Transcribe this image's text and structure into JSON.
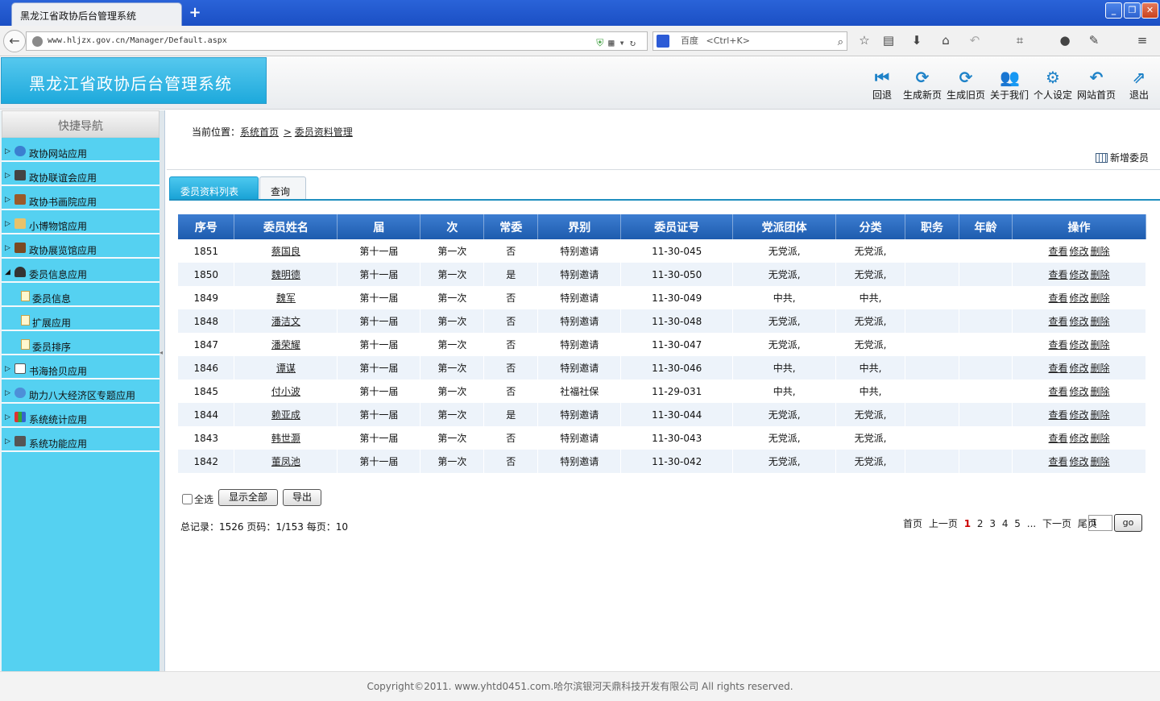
{
  "browser": {
    "tab_title": "黑龙江省政协后台管理系统",
    "new_tab": "+",
    "url": "www.hljzx.gov.cn/Manager/Default.aspx",
    "search_engine": "百度",
    "search_hint": "<Ctrl+K>"
  },
  "header": {
    "app_title": "黑龙江省政协后台管理系统",
    "buttons": [
      {
        "label": "回退",
        "icon": "rewind-icon"
      },
      {
        "label": "生成新页",
        "icon": "refresh-icon"
      },
      {
        "label": "生成旧页",
        "icon": "refresh-icon"
      },
      {
        "label": "关于我们",
        "icon": "users-icon"
      },
      {
        "label": "个人设定",
        "icon": "gear-icon"
      },
      {
        "label": "网站首页",
        "icon": "back-arrow-icon"
      },
      {
        "label": "退出",
        "icon": "exit-icon"
      }
    ]
  },
  "sidebar": {
    "title": "快捷导航",
    "items": [
      {
        "label": "政协网站应用"
      },
      {
        "label": "政协联谊会应用"
      },
      {
        "label": "政协书画院应用"
      },
      {
        "label": "小博物馆应用"
      },
      {
        "label": "政协展览馆应用"
      },
      {
        "label": "委员信息应用"
      },
      {
        "label": "书海拾贝应用"
      },
      {
        "label": "助力八大经济区专题应用"
      },
      {
        "label": "系统统计应用"
      },
      {
        "label": "系统功能应用"
      }
    ],
    "subitems": [
      {
        "label": "委员信息"
      },
      {
        "label": "扩展应用"
      },
      {
        "label": "委员排序"
      }
    ]
  },
  "main": {
    "breadcrumb_prefix": "当前位置：",
    "breadcrumb_home": "系统首页",
    "breadcrumb_sep": ">",
    "breadcrumb_current": "委员资料管理",
    "add_button": "新增委员",
    "tabs": [
      "委员资料列表",
      "查询"
    ],
    "columns": [
      "序号",
      "委员姓名",
      "届",
      "次",
      "常委",
      "界别",
      "委员证号",
      "党派团体",
      "分类",
      "职务",
      "年龄",
      "操作"
    ],
    "action_labels": [
      "查看",
      "修改",
      "删除"
    ],
    "rows": [
      [
        "1851",
        "蔡国良",
        "第十一届",
        "第一次",
        "否",
        "特别邀请",
        "11-30-045",
        "无党派,",
        "无党派,",
        "",
        ""
      ],
      [
        "1850",
        "魏明德",
        "第十一届",
        "第一次",
        "是",
        "特别邀请",
        "11-30-050",
        "无党派,",
        "无党派,",
        "",
        ""
      ],
      [
        "1849",
        "魏军",
        "第十一届",
        "第一次",
        "否",
        "特别邀请",
        "11-30-049",
        "中共,",
        "中共,",
        "",
        ""
      ],
      [
        "1848",
        "潘洁文",
        "第十一届",
        "第一次",
        "否",
        "特别邀请",
        "11-30-048",
        "无党派,",
        "无党派,",
        "",
        ""
      ],
      [
        "1847",
        "潘荣耀",
        "第十一届",
        "第一次",
        "否",
        "特别邀请",
        "11-30-047",
        "无党派,",
        "无党派,",
        "",
        ""
      ],
      [
        "1846",
        "谭谋",
        "第十一届",
        "第一次",
        "否",
        "特别邀请",
        "11-30-046",
        "中共,",
        "中共,",
        "",
        ""
      ],
      [
        "1845",
        "付小波",
        "第十一届",
        "第一次",
        "否",
        "社福社保",
        "11-29-031",
        "中共,",
        "中共,",
        "",
        ""
      ],
      [
        "1844",
        "赖亚成",
        "第十一届",
        "第一次",
        "是",
        "特别邀请",
        "11-30-044",
        "无党派,",
        "无党派,",
        "",
        ""
      ],
      [
        "1843",
        "韩世灏",
        "第十一届",
        "第一次",
        "否",
        "特别邀请",
        "11-30-043",
        "无党派,",
        "无党派,",
        "",
        ""
      ],
      [
        "1842",
        "董凤池",
        "第十一届",
        "第一次",
        "否",
        "特别邀请",
        "11-30-042",
        "无党派,",
        "无党派,",
        "",
        ""
      ]
    ],
    "select_all": "全选",
    "show_all_button": "显示全部",
    "export_button": "导出",
    "summary": "总记录：1526 页码：1/153 每页：10",
    "pager": {
      "first": "首页",
      "prev": "上一页",
      "current": "1",
      "pages": [
        "2",
        "3",
        "4",
        "5"
      ],
      "ellipsis": "...",
      "next": "下一页",
      "last": "尾页",
      "page_value": "1",
      "go": "go"
    }
  },
  "footer": {
    "text": "Copyright©2011. www.yhtd0451.com.哈尔滨银河天鼎科技开发有限公司 All rights reserved."
  },
  "colors": {
    "accent": "#1aa3d6",
    "sidebar_bg": "#55d1f1",
    "table_header": "#2a6bbf"
  }
}
